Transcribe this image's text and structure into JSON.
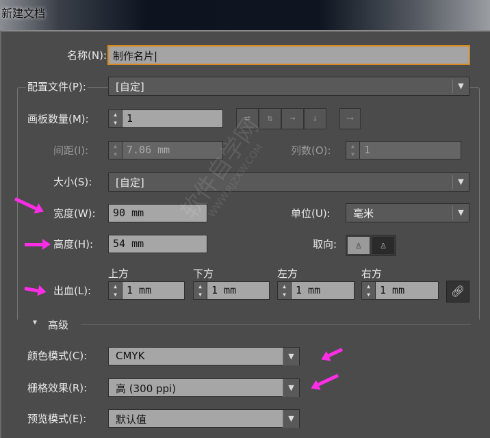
{
  "window": {
    "title": "新建文档"
  },
  "fields": {
    "name": {
      "label": "名称(N):",
      "value": "制作名片"
    },
    "profile": {
      "label": "配置文件(P):",
      "value": "[自定]"
    },
    "artboards": {
      "label": "画板数量(M):",
      "value": "1"
    },
    "spacing": {
      "label": "间距(I):",
      "value": "7.06 mm"
    },
    "columns": {
      "label": "列数(O):",
      "value": "1"
    },
    "size": {
      "label": "大小(S):",
      "value": "[自定]"
    },
    "width": {
      "label": "宽度(W):",
      "value": "90 mm"
    },
    "units": {
      "label": "单位(U):",
      "value": "毫米"
    },
    "height": {
      "label": "高度(H):",
      "value": "54 mm"
    },
    "orientation": {
      "label": "取向:"
    },
    "bleed": {
      "label": "出血(L):",
      "top_label": "上方",
      "top": "1 mm",
      "bottom_label": "下方",
      "bottom": "1 mm",
      "left_label": "左方",
      "left": "1 mm",
      "right_label": "右方",
      "right": "1 mm"
    }
  },
  "advanced": {
    "label": "高级",
    "color_mode": {
      "label": "颜色模式(C):",
      "value": "CMYK"
    },
    "raster": {
      "label": "栅格效果(R):",
      "value": "高 (300 ppi)"
    },
    "preview": {
      "label": "预览模式(E):",
      "value": "默认值"
    }
  },
  "watermark": {
    "text": "软件自学网",
    "url": "WWW.RJZXW.COM"
  },
  "colors": {
    "accent": "#d98a1f",
    "annotation": "#ff2ee6"
  }
}
